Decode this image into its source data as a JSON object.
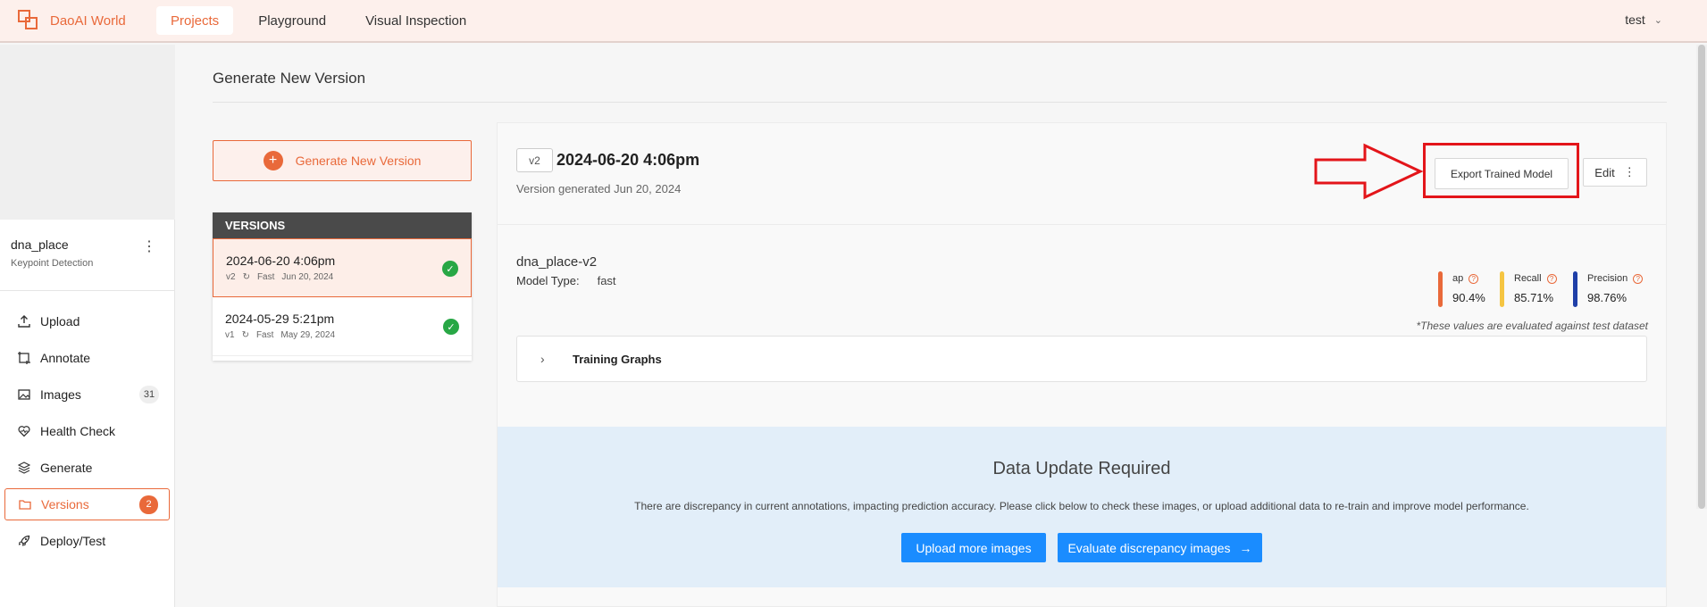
{
  "topbar": {
    "brand": "DaoAI World",
    "tabs": [
      {
        "label": "Projects",
        "active": true
      },
      {
        "label": "Playground",
        "active": false
      },
      {
        "label": "Visual Inspection",
        "active": false
      }
    ],
    "user": "test"
  },
  "sidebar": {
    "project_name": "dna_place",
    "project_type": "Keypoint Detection",
    "items": [
      {
        "label": "Upload",
        "icon": "upload-icon"
      },
      {
        "label": "Annotate",
        "icon": "annotate-icon"
      },
      {
        "label": "Images",
        "icon": "images-icon",
        "count": "31"
      },
      {
        "label": "Health Check",
        "icon": "heart-pulse-icon"
      },
      {
        "label": "Generate",
        "icon": "layers-icon"
      },
      {
        "label": "Versions",
        "icon": "folder-icon",
        "count": "2",
        "active": true
      },
      {
        "label": "Deploy/Test",
        "icon": "rocket-icon"
      }
    ]
  },
  "main": {
    "page_title": "Generate New Version",
    "generate_button": "Generate New Version",
    "versions_header": "VERSIONS",
    "versions": [
      {
        "date": "2024-06-20 4:06pm",
        "tag": "v2",
        "speed": "Fast",
        "created": "Jun 20, 2024",
        "active": true
      },
      {
        "date": "2024-05-29 5:21pm",
        "tag": "v1",
        "speed": "Fast",
        "created": "May 29, 2024",
        "active": false
      }
    ],
    "detail": {
      "badge": "v2",
      "title": "2024-06-20 4:06pm",
      "subtitle": "Version generated Jun 20, 2024",
      "export_button": "Export Trained Model",
      "edit_button": "Edit",
      "model_name": "dna_place-v2",
      "model_type_label": "Model Type:",
      "model_type_value": "fast",
      "metrics": [
        {
          "label": "ap",
          "value": "90.4%",
          "color": "#e9693a"
        },
        {
          "label": "Recall",
          "value": "85.71%",
          "color": "#f5c542"
        },
        {
          "label": "Precision",
          "value": "98.76%",
          "color": "#1f3fa8"
        }
      ],
      "eval_note": "*These values are evaluated against test dataset",
      "training_graphs": "Training Graphs"
    },
    "update": {
      "title": "Data Update Required",
      "text": "There are discrepancy in current annotations, impacting prediction accuracy. Please click below to check these images, or upload additional data to re-train and improve model performance.",
      "upload_button": "Upload more images",
      "evaluate_button": "Evaluate discrepancy images"
    }
  },
  "colors": {
    "accent": "#e9693a",
    "highlight_red": "#e3151a",
    "primary_blue": "#1a8cff",
    "success_green": "#28a745"
  }
}
